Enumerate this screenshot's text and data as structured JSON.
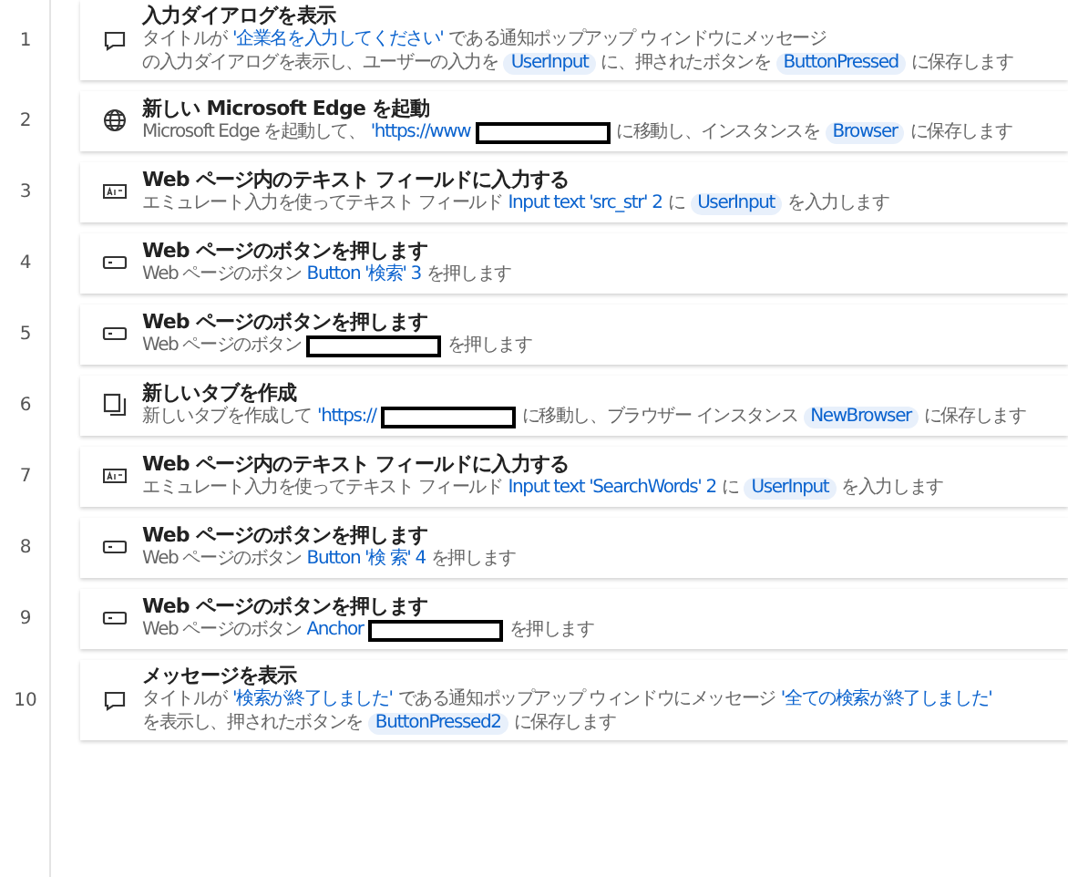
{
  "steps": [
    {
      "number": "1",
      "kind": "message",
      "title": "入力ダイアログを表示",
      "description": [
        {
          "kind": "text",
          "text": "タイトルが"
        },
        {
          "kind": "value",
          "text": "'企業名を入力してください'"
        },
        {
          "kind": "text",
          "text": "である通知ポップアップ ウィンドウにメッセージ"
        },
        {
          "kind": "text",
          "text": "の入力ダイアログを表示し、ユーザーの入力を"
        },
        {
          "kind": "variable",
          "text": "UserInput"
        },
        {
          "kind": "text",
          "text": "に、押されたボタンを"
        },
        {
          "kind": "variable",
          "text": "ButtonPressed"
        },
        {
          "kind": "text",
          "text": "に保存します"
        }
      ]
    },
    {
      "number": "2",
      "kind": "globe",
      "title": "新しい Microsoft Edge を起動",
      "description": [
        {
          "kind": "text",
          "text": "Microsoft Edge を起動して、"
        },
        {
          "kind": "value",
          "text": "'https://www"
        },
        {
          "kind": "redacted"
        },
        {
          "kind": "text",
          "text": "に移動し、インスタンスを"
        },
        {
          "kind": "variable",
          "text": "Browser"
        },
        {
          "kind": "text",
          "text": "に保存します"
        }
      ]
    },
    {
      "number": "3",
      "kind": "textfield",
      "title": "Web ページ内のテキスト フィールドに入力する",
      "description": [
        {
          "kind": "text",
          "text": "エミュレート入力を使ってテキスト フィールド"
        },
        {
          "kind": "value",
          "text": "Input text 'src_str' 2"
        },
        {
          "kind": "text",
          "text": "に"
        },
        {
          "kind": "variable",
          "text": "UserInput"
        },
        {
          "kind": "text",
          "text": "を入力します"
        }
      ]
    },
    {
      "number": "4",
      "kind": "button",
      "title": "Web ページのボタンを押します",
      "description": [
        {
          "kind": "text",
          "text": "Web ページのボタン"
        },
        {
          "kind": "value",
          "text": "Button '検索' 3"
        },
        {
          "kind": "text",
          "text": "を押します"
        }
      ]
    },
    {
      "number": "5",
      "kind": "button",
      "title": "Web ページのボタンを押します",
      "description": [
        {
          "kind": "text",
          "text": "Web ページのボタン"
        },
        {
          "kind": "redacted"
        },
        {
          "kind": "text",
          "text": "を押します"
        }
      ]
    },
    {
      "number": "6",
      "kind": "tab",
      "title": "新しいタブを作成",
      "description": [
        {
          "kind": "text",
          "text": "新しいタブを作成して"
        },
        {
          "kind": "value",
          "text": "'https://"
        },
        {
          "kind": "redacted"
        },
        {
          "kind": "text",
          "text": "に移動し、ブラウザー インスタンス"
        },
        {
          "kind": "variable",
          "text": "NewBrowser"
        },
        {
          "kind": "text",
          "text": "に保存します"
        }
      ]
    },
    {
      "number": "7",
      "kind": "textfield",
      "title": "Web ページ内のテキスト フィールドに入力する",
      "description": [
        {
          "kind": "text",
          "text": "エミュレート入力を使ってテキスト フィールド"
        },
        {
          "kind": "value",
          "text": "Input text 'SearchWords' 2"
        },
        {
          "kind": "text",
          "text": "に"
        },
        {
          "kind": "variable",
          "text": "UserInput"
        },
        {
          "kind": "text",
          "text": "を入力します"
        }
      ]
    },
    {
      "number": "8",
      "kind": "button",
      "title": "Web ページのボタンを押します",
      "description": [
        {
          "kind": "text",
          "text": "Web ページのボタン"
        },
        {
          "kind": "value",
          "text": "Button '検 索' 4"
        },
        {
          "kind": "text",
          "text": "を押します"
        }
      ]
    },
    {
      "number": "9",
      "kind": "button",
      "title": "Web ページのボタンを押します",
      "description": [
        {
          "kind": "text",
          "text": "Web ページのボタン"
        },
        {
          "kind": "value",
          "text": "Anchor"
        },
        {
          "kind": "redacted"
        },
        {
          "kind": "text",
          "text": "を押します"
        }
      ]
    },
    {
      "number": "10",
      "kind": "message",
      "title": "メッセージを表示",
      "description": [
        {
          "kind": "text",
          "text": "タイトルが"
        },
        {
          "kind": "value",
          "text": "'検索が終了しました'"
        },
        {
          "kind": "text",
          "text": "である通知ポップアップ ウィンドウにメッセージ"
        },
        {
          "kind": "value",
          "text": "'全ての検索が終了しました'"
        },
        {
          "kind": "text",
          "text": "を表示し、押されたボタンを"
        },
        {
          "kind": "variable",
          "text": "ButtonPressed2"
        },
        {
          "kind": "text",
          "text": "に保存します"
        }
      ]
    }
  ]
}
